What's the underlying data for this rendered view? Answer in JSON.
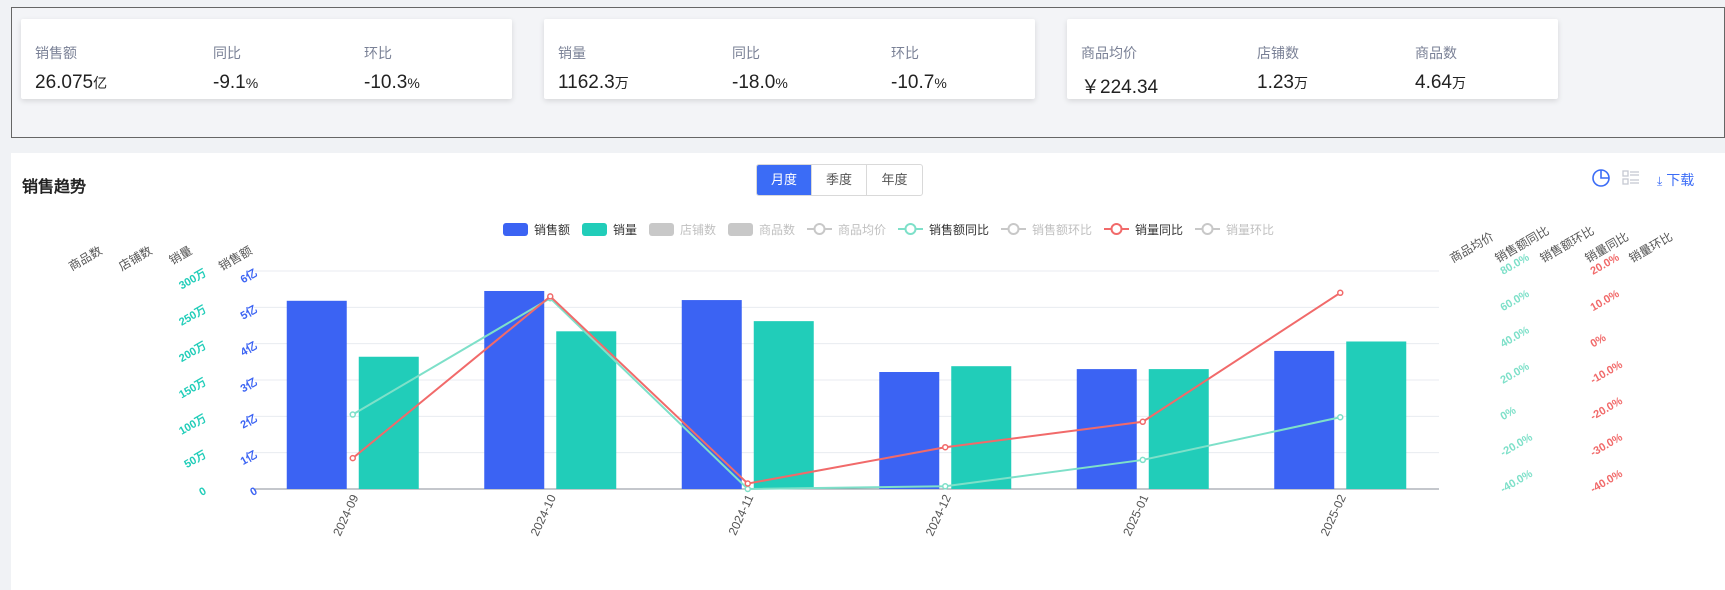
{
  "cards": [
    {
      "metrics": [
        {
          "label": "销售额",
          "value": "26.075",
          "unit": "亿"
        },
        {
          "label": "同比",
          "value": "-9.1",
          "unit": "%"
        },
        {
          "label": "环比",
          "value": "-10.3",
          "unit": "%"
        }
      ]
    },
    {
      "metrics": [
        {
          "label": "销量",
          "value": "1162.3",
          "unit": "万"
        },
        {
          "label": "同比",
          "value": "-18.0",
          "unit": "%"
        },
        {
          "label": "环比",
          "value": "-10.7",
          "unit": "%"
        }
      ]
    },
    {
      "metrics": [
        {
          "label": "商品均价",
          "value": "￥224.34",
          "unit": ""
        },
        {
          "label": "店铺数",
          "value": "1.23",
          "unit": "万"
        },
        {
          "label": "商品数",
          "value": "4.64",
          "unit": "万"
        }
      ]
    }
  ],
  "panel": {
    "title": "销售趋势",
    "tabs": [
      "月度",
      "季度",
      "年度"
    ],
    "active_tab": "月度",
    "download_label": "下载",
    "icons": [
      "pie-chart-icon",
      "list-icon",
      "download-icon"
    ]
  },
  "colors": {
    "blue": "#3b63f3",
    "teal": "#21cdb9",
    "red": "#f16a6a",
    "mint": "#7ee0c9",
    "grey": "#c8c8c8",
    "accent": "#3b6cf6"
  },
  "chart_data": {
    "type": "bar",
    "categories": [
      "2024-09",
      "2024-10",
      "2024-11",
      "2024-12",
      "2025-01",
      "2025-02"
    ],
    "legend": [
      {
        "name": "销售额",
        "kind": "bar",
        "active": true,
        "color": "#3b63f3"
      },
      {
        "name": "销量",
        "kind": "bar",
        "active": true,
        "color": "#21cdb9"
      },
      {
        "name": "店铺数",
        "kind": "bar",
        "active": false,
        "color": "#c8c8c8"
      },
      {
        "name": "商品数",
        "kind": "bar",
        "active": false,
        "color": "#c8c8c8"
      },
      {
        "name": "商品均价",
        "kind": "line",
        "active": false,
        "color": "#c8c8c8"
      },
      {
        "name": "销售额同比",
        "kind": "line",
        "active": true,
        "color": "#7ee0c9"
      },
      {
        "name": "销售额环比",
        "kind": "line",
        "active": false,
        "color": "#c8c8c8"
      },
      {
        "name": "销量同比",
        "kind": "line",
        "active": true,
        "color": "#f16a6a"
      },
      {
        "name": "销量环比",
        "kind": "line",
        "active": false,
        "color": "#c8c8c8"
      }
    ],
    "left_axis_names": [
      "商品数",
      "店铺数",
      "销量",
      "销售额"
    ],
    "right_axis_names": [
      "商品均价",
      "销售额同比",
      "销售额环比",
      "销量同比",
      "销量环比"
    ],
    "axes": {
      "sales": {
        "name": "销售额",
        "ticks": [
          "0",
          "1亿",
          "2亿",
          "3亿",
          "4亿",
          "5亿",
          "6亿"
        ],
        "min": 0,
        "max": 6,
        "color": "#3b63f3"
      },
      "volume": {
        "name": "销量",
        "ticks": [
          "0",
          "50万",
          "100万",
          "150万",
          "200万",
          "250万",
          "300万"
        ],
        "min": 0,
        "max": 300,
        "color": "#21cdb9"
      },
      "sales_yoy": {
        "name": "销售额同比",
        "ticks": [
          "-40.0%",
          "-20.0%",
          "0%",
          "20.0%",
          "40.0%",
          "60.0%",
          "80.0%"
        ],
        "min": -40,
        "max": 80,
        "color": "#7ee0c9"
      },
      "volume_yoy": {
        "name": "销量同比",
        "ticks": [
          "-40.0%",
          "-30.0%",
          "-20.0%",
          "-10.0%",
          "0%",
          "10.0%",
          "20.0%"
        ],
        "min": -40,
        "max": 20,
        "color": "#f16a6a"
      }
    },
    "series": [
      {
        "name": "销售额",
        "kind": "bar",
        "axis": "sales",
        "unit": "亿",
        "values": [
          5.18,
          5.45,
          5.2,
          3.22,
          3.3,
          3.8
        ],
        "color": "#3b63f3"
      },
      {
        "name": "销量",
        "kind": "bar",
        "axis": "volume",
        "unit": "万",
        "values": [
          182,
          217,
          231,
          169,
          165,
          203
        ],
        "color": "#21cdb9"
      },
      {
        "name": "销售额同比",
        "kind": "line",
        "axis": "sales_yoy",
        "unit": "%",
        "values": [
          1,
          65,
          -40,
          -38.5,
          -24,
          -0.5
        ],
        "color": "#7ee0c9"
      },
      {
        "name": "销量同比",
        "kind": "line",
        "axis": "volume_yoy",
        "unit": "%",
        "values": [
          -31.5,
          13,
          -38.5,
          -28.5,
          -21.5,
          14
        ],
        "color": "#f16a6a"
      }
    ]
  }
}
